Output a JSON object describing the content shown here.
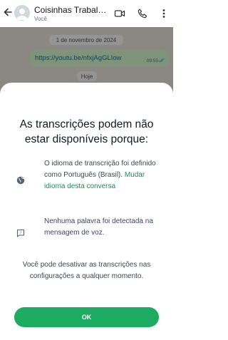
{
  "header": {
    "title": "Coisinhas Trabalh...",
    "subtitle": "Você"
  },
  "chat": {
    "date_chip": "1 de novembro de 2024",
    "message": {
      "text": "https://youtu.be/nfxjAgGLIow",
      "time": "09:55"
    },
    "today_chip": "Hoje"
  },
  "sheet": {
    "title": "As transcrições podem não estar disponíveis porque:",
    "reasons": [
      {
        "icon": "globe-icon",
        "text": "O idioma de transcrição foi definido como Português (Brasil). ",
        "link": "Mudar idioma desta conversa"
      },
      {
        "icon": "voice-message-icon",
        "text": "Nenhuma palavra foi detectada na mensagem de voz."
      }
    ],
    "note": "Você pode desativar as transcrições nas configurações a qualquer momento.",
    "ok_label": "OK"
  },
  "colors": {
    "accent": "#1daa61",
    "link": "#1e8f53",
    "bubble": "#d9fdd3"
  }
}
